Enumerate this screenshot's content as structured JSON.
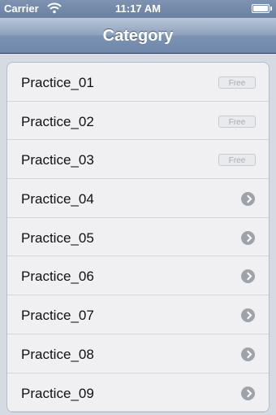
{
  "status_bar": {
    "carrier": "Carrier",
    "time": "11:17 AM",
    "icons": [
      "wifi-icon",
      "battery-icon"
    ]
  },
  "nav_bar": {
    "title": "Category"
  },
  "list": {
    "items": [
      {
        "label": "Practice_01",
        "accessory": "free-badge",
        "badge": "Free"
      },
      {
        "label": "Practice_02",
        "accessory": "free-badge",
        "badge": "Free"
      },
      {
        "label": "Practice_03",
        "accessory": "free-badge",
        "badge": "Free"
      },
      {
        "label": "Practice_04",
        "accessory": "chevron-icon"
      },
      {
        "label": "Practice_05",
        "accessory": "chevron-icon"
      },
      {
        "label": "Practice_06",
        "accessory": "chevron-icon"
      },
      {
        "label": "Practice_07",
        "accessory": "chevron-icon"
      },
      {
        "label": "Practice_08",
        "accessory": "chevron-icon"
      },
      {
        "label": "Practice_09",
        "accessory": "chevron-icon"
      }
    ]
  },
  "colors": {
    "nav_bar": "#7b92b3",
    "background": "#d6dbe3",
    "list_background": "#f0f0f3"
  }
}
